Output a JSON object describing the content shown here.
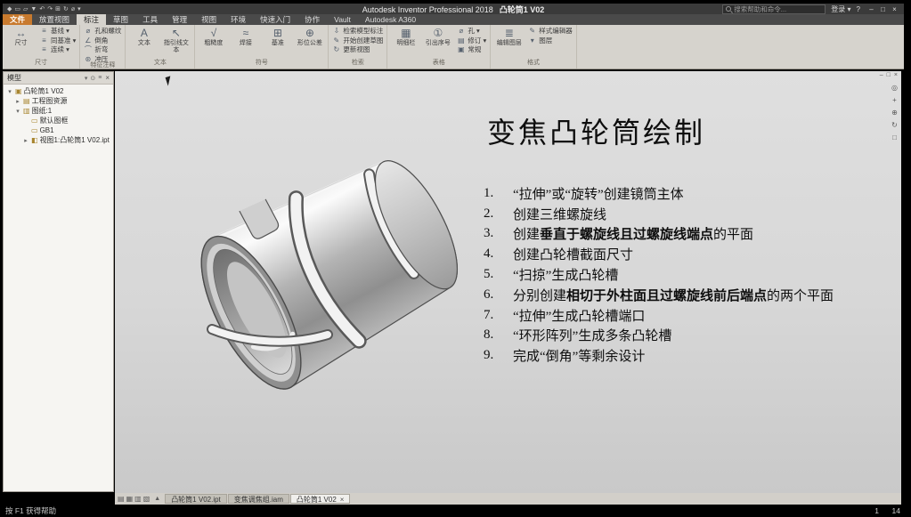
{
  "colors": {
    "file_tab": "#c87a2e",
    "titlebar_bg": "#3a3a3a",
    "ribbon_bg": "#d6d3cd",
    "canvas_bg": "#d7d7d7"
  },
  "titlebar": {
    "app_title": "Autodesk Inventor Professional 2018",
    "doc_title": "凸轮筒1 V02",
    "search_placeholder": "搜索帮助和命令...",
    "sign_in_label": "登录",
    "dropdown_glyph": "▾",
    "help_label": "?",
    "qat_icons": [
      {
        "name": "inventor-logo-icon",
        "glyph": "◆"
      },
      {
        "name": "new-file-icon",
        "glyph": "▭"
      },
      {
        "name": "open-file-icon",
        "glyph": "▱"
      },
      {
        "name": "save-icon",
        "glyph": "▼"
      },
      {
        "name": "undo-icon",
        "glyph": "↶"
      },
      {
        "name": "redo-icon",
        "glyph": "↷"
      },
      {
        "name": "print-icon",
        "glyph": "⊞"
      },
      {
        "name": "update-icon",
        "glyph": "↻"
      },
      {
        "name": "measure-icon",
        "glyph": "⌀"
      },
      {
        "name": "appearance-dropdown-icon",
        "glyph": "▾"
      }
    ],
    "window_buttons": [
      {
        "name": "minimize-button",
        "glyph": "–"
      },
      {
        "name": "restore-button",
        "glyph": "□"
      },
      {
        "name": "close-button",
        "glyph": "×"
      }
    ]
  },
  "ribbon": {
    "file_tab": "文件",
    "active_tab": "标注",
    "tabs": [
      "文件",
      "放置视图",
      "标注",
      "草图",
      "工具",
      "管理",
      "视图",
      "环境",
      "快速入门",
      "协作",
      "Vault",
      "Autodesk A360"
    ],
    "panels": [
      {
        "name": "dimension-panel",
        "label": "尺寸",
        "big": [
          {
            "name": "dimension-button",
            "glyph": "↔",
            "label": "尺寸"
          }
        ],
        "small": [
          {
            "name": "baseline-dimension-button",
            "glyph": "≡",
            "label": "基线 ▾"
          },
          {
            "name": "ordinate-dimension-button",
            "glyph": "≡",
            "label": "同基准 ▾"
          },
          {
            "name": "chain-dimension-button",
            "glyph": "≡",
            "label": "连续 ▾"
          }
        ]
      },
      {
        "name": "feature-notes-panel",
        "label": "特征注释",
        "big": [],
        "small": [
          {
            "name": "hole-thread-note-button",
            "glyph": "⌀",
            "label": "孔和螺纹"
          },
          {
            "name": "chamfer-note-button",
            "glyph": "∠",
            "label": "倒角"
          },
          {
            "name": "bend-note-button",
            "glyph": "⌒",
            "label": "折弯"
          },
          {
            "name": "punch-note-button",
            "glyph": "⊛",
            "label": "冲压"
          }
        ]
      },
      {
        "name": "text-panel",
        "label": "文本",
        "big": [
          {
            "name": "text-button",
            "glyph": "A",
            "label": "文本"
          },
          {
            "name": "leader-text-button",
            "glyph": "↖",
            "label": "指引线文本"
          }
        ],
        "small": []
      },
      {
        "name": "symbols-panel",
        "label": "符号",
        "big": [
          {
            "name": "surface-texture-button",
            "glyph": "√",
            "label": "粗糙度"
          },
          {
            "name": "welding-symbol-button",
            "glyph": "≈",
            "label": "焊接"
          },
          {
            "name": "datum-identifier-button",
            "glyph": "⊞",
            "label": "基准"
          },
          {
            "name": "feature-control-frame-button",
            "glyph": "⊕",
            "label": "形位公差"
          }
        ],
        "small": []
      },
      {
        "name": "retrieve-panel",
        "label": "检索",
        "big": [],
        "small": [
          {
            "name": "retrieve-model-annotations-button",
            "glyph": "⇩",
            "label": "检索模型标注"
          },
          {
            "name": "start-sketch-button",
            "glyph": "✎",
            "label": "开始创建草图"
          },
          {
            "name": "update-views-button",
            "glyph": "↻",
            "label": "更新视图"
          }
        ]
      },
      {
        "name": "table-panel",
        "label": "表格",
        "big": [
          {
            "name": "parts-list-button",
            "glyph": "▦",
            "label": "明细栏"
          },
          {
            "name": "balloon-button",
            "glyph": "①",
            "label": "引出序号"
          }
        ],
        "small": [
          {
            "name": "hole-table-button",
            "glyph": "⌀",
            "label": "孔 ▾"
          },
          {
            "name": "revision-table-button",
            "glyph": "▤",
            "label": "修订 ▾"
          },
          {
            "name": "general-table-button",
            "glyph": "▣",
            "label": "常规"
          }
        ]
      },
      {
        "name": "format-panel",
        "label": "格式",
        "big": [
          {
            "name": "edit-layers-button",
            "glyph": "≣",
            "label": "编辑图层"
          }
        ],
        "small": [
          {
            "name": "styles-editor-button",
            "glyph": "✎",
            "label": "样式编辑器"
          },
          {
            "name": "layer-dropdown",
            "glyph": "▾",
            "label": "图层"
          }
        ]
      }
    ]
  },
  "browser": {
    "panel_title": "模型",
    "close_glyph": "×",
    "header_icons": [
      {
        "name": "browser-filter-icon",
        "glyph": "▾"
      },
      {
        "name": "browser-search-icon",
        "glyph": "⊙"
      },
      {
        "name": "browser-menu-icon",
        "glyph": "≡"
      }
    ],
    "tree": [
      {
        "depth": 0,
        "exp": "open",
        "icon_name": "drawing-document-icon",
        "glyph": "▣",
        "label": "凸轮筒1 V02"
      },
      {
        "depth": 1,
        "exp": "closed",
        "icon_name": "drawing-resources-icon",
        "glyph": "▤",
        "label": "工程图资源"
      },
      {
        "depth": 1,
        "exp": "open",
        "icon_name": "sheet-icon",
        "glyph": "▥",
        "label": "图纸:1"
      },
      {
        "depth": 2,
        "exp": "",
        "icon_name": "border-icon",
        "glyph": "▭",
        "label": "默认图框"
      },
      {
        "depth": 2,
        "exp": "",
        "icon_name": "title-block-icon",
        "glyph": "▭",
        "label": "GB1"
      },
      {
        "depth": 2,
        "exp": "closed",
        "icon_name": "view-icon",
        "glyph": "◧",
        "label": "视图1:凸轮筒1 V02.ipt"
      }
    ]
  },
  "canvas": {
    "title": "变焦凸轮筒绘制",
    "steps": [
      {
        "num": "1.",
        "parts": [
          {
            "t": "“拉伸”或“旋转”创建镜筒主体"
          }
        ]
      },
      {
        "num": "2.",
        "parts": [
          {
            "t": "创建三维螺旋线"
          }
        ]
      },
      {
        "num": "3.",
        "parts": [
          {
            "t": "创建"
          },
          {
            "t": "垂直于螺旋线且过螺旋线端点",
            "b": true
          },
          {
            "t": "的平面"
          }
        ]
      },
      {
        "num": "4.",
        "parts": [
          {
            "t": "创建凸轮槽截面尺寸"
          }
        ]
      },
      {
        "num": "5.",
        "parts": [
          {
            "t": "“扫掠”生成凸轮槽"
          }
        ]
      },
      {
        "num": "6.",
        "parts": [
          {
            "t": "分别创建"
          },
          {
            "t": "相切于外柱面且过螺旋线前后端点",
            "b": true
          },
          {
            "t": "的两个平面"
          }
        ]
      },
      {
        "num": "7.",
        "parts": [
          {
            "t": "“拉伸”生成凸轮槽端口"
          }
        ]
      },
      {
        "num": "8.",
        "parts": [
          {
            "t": "“环形阵列”生成多条凸轮槽"
          }
        ]
      },
      {
        "num": "9.",
        "parts": [
          {
            "t": "完成“倒角”等剩余设计"
          }
        ]
      }
    ],
    "nav_icons": [
      {
        "name": "navigation-wheel-icon",
        "glyph": "◎"
      },
      {
        "name": "pan-icon",
        "glyph": "+"
      },
      {
        "name": "zoom-icon",
        "glyph": "⊕"
      },
      {
        "name": "orbit-icon",
        "glyph": "↻"
      },
      {
        "name": "look-at-icon",
        "glyph": "□"
      }
    ],
    "window_controls": [
      {
        "name": "doc-minimize-icon",
        "glyph": "–"
      },
      {
        "name": "doc-restore-icon",
        "glyph": "□"
      },
      {
        "name": "doc-close-icon",
        "glyph": "×"
      }
    ]
  },
  "doctabs": {
    "collapse_glyph": "▲",
    "icons": [
      {
        "name": "arrange-cascade-icon",
        "glyph": "▤"
      },
      {
        "name": "arrange-tile-icon",
        "glyph": "▦"
      },
      {
        "name": "arrange-horizontal-icon",
        "glyph": "▥"
      },
      {
        "name": "arrange-vertical-icon",
        "glyph": "▧"
      }
    ],
    "tabs": [
      {
        "label": "凸轮筒1 V02.ipt"
      },
      {
        "label": "变焦调焦组.iam"
      },
      {
        "label": "凸轮筒1 V02",
        "active": true,
        "close": "×"
      }
    ]
  },
  "statusbar": {
    "help_text": "按 F1 获得帮助",
    "page_current": "1",
    "page_total": "14"
  }
}
